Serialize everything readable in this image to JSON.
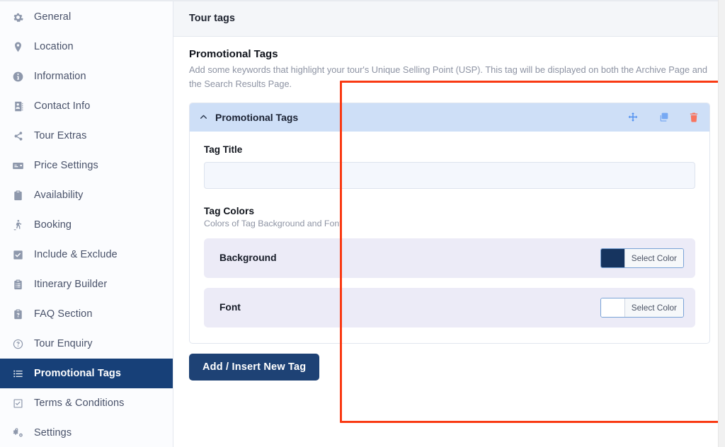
{
  "sidebar": {
    "items": [
      {
        "label": "General",
        "icon": "gear-icon",
        "active": false
      },
      {
        "label": "Location",
        "icon": "map-pin-icon",
        "active": false
      },
      {
        "label": "Information",
        "icon": "info-circle-icon",
        "active": false
      },
      {
        "label": "Contact Info",
        "icon": "contact-book-icon",
        "active": false
      },
      {
        "label": "Tour Extras",
        "icon": "share-nodes-icon",
        "active": false
      },
      {
        "label": "Price Settings",
        "icon": "credit-card-icon",
        "active": false
      },
      {
        "label": "Availability",
        "icon": "clipboard-icon",
        "active": false
      },
      {
        "label": "Booking",
        "icon": "traveler-icon",
        "active": false
      },
      {
        "label": "Include & Exclude",
        "icon": "checkbox-check-icon",
        "active": false
      },
      {
        "label": "Itinerary Builder",
        "icon": "clipboard-list-icon",
        "active": false
      },
      {
        "label": "FAQ Section",
        "icon": "clipboard-question-icon",
        "active": false
      },
      {
        "label": "Tour Enquiry",
        "icon": "question-circle-icon",
        "active": false
      },
      {
        "label": "Promotional Tags",
        "icon": "list-icon",
        "active": true
      },
      {
        "label": "Terms & Conditions",
        "icon": "checkbox-outline-icon",
        "active": false
      },
      {
        "label": "Settings",
        "icon": "gears-icon",
        "active": false
      }
    ]
  },
  "panel": {
    "header_title": "Tour tags",
    "section_title": "Promotional Tags",
    "section_desc": "Add some keywords that highlight your tour's Unique Selling Point (USP). This tag will be displayed on both the Archive Page and the Search Results Page."
  },
  "tag_card": {
    "title": "Promotional Tags",
    "collapse_icon": "chevron-up-icon",
    "actions": [
      {
        "name": "move-icon",
        "title": "Move",
        "color": "#4b8df0"
      },
      {
        "name": "duplicate-icon",
        "title": "Duplicate",
        "color": "#77a9f3"
      },
      {
        "name": "trash-icon",
        "title": "Delete",
        "color": "#f8745f"
      }
    ],
    "tag_title_label": "Tag Title",
    "tag_title_value": "",
    "tag_title_placeholder": "",
    "colors_title": "Tag Colors",
    "colors_desc": "Colors of Tag Background and Font",
    "color_rows": [
      {
        "label": "Background",
        "swatch": "#16345f",
        "button_label": "Select Color"
      },
      {
        "label": "Font",
        "swatch": "#ffffff",
        "button_label": "Select Color"
      }
    ]
  },
  "footer": {
    "add_button_label": "Add / Insert New Tag"
  },
  "theme": {
    "sidebar_active_bg": "#174078",
    "card_header_bg": "#cedff7",
    "color_row_bg": "#ecebf7",
    "primary_button_bg": "#1e4275",
    "annotation_border": "#f93a13"
  }
}
